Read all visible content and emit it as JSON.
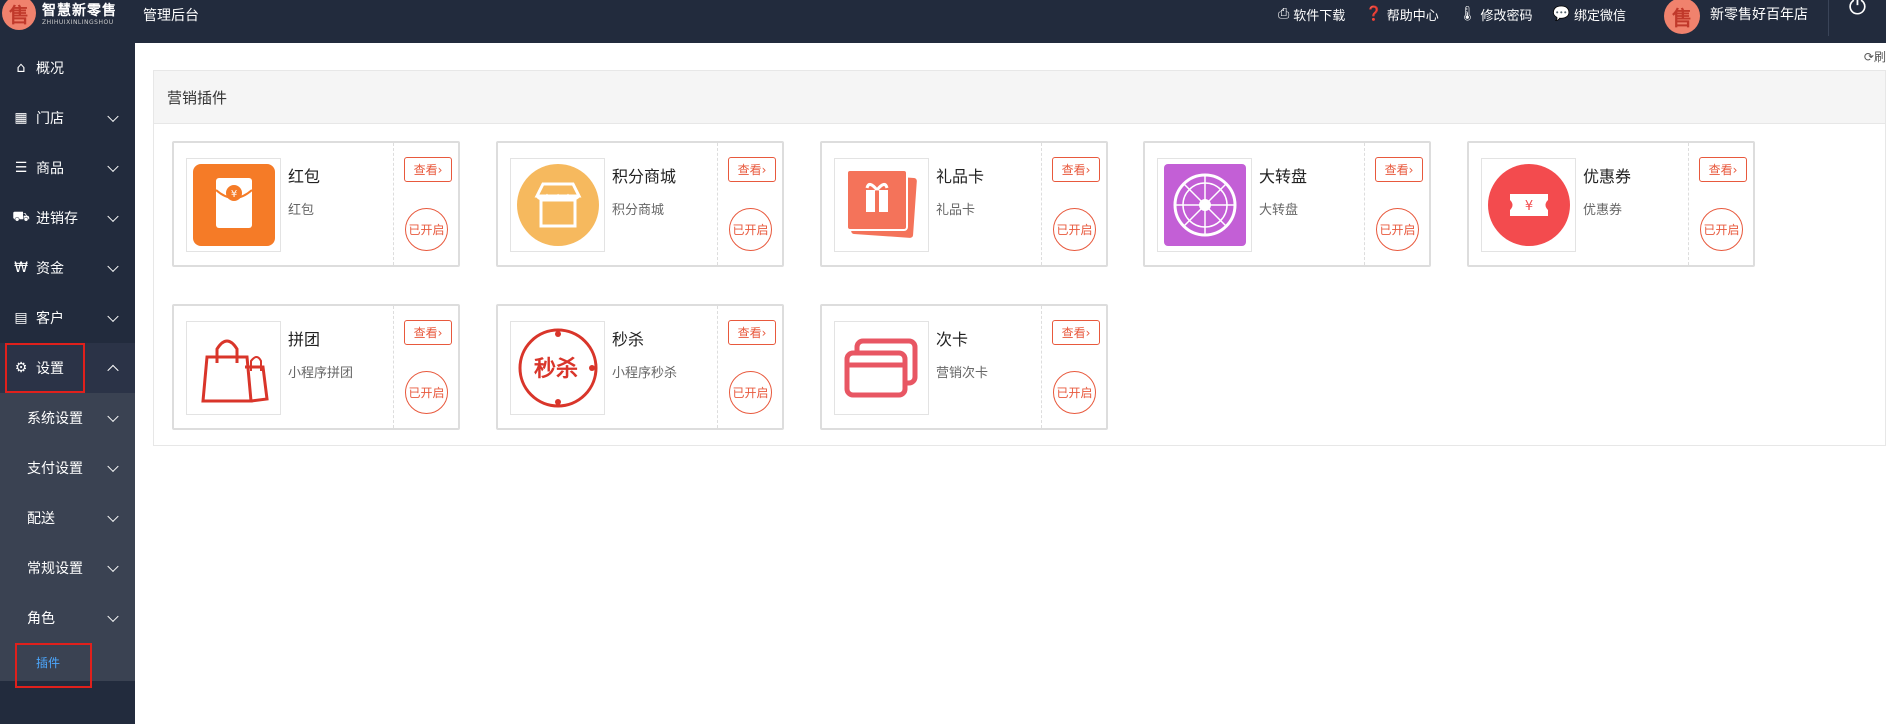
{
  "topbar": {
    "logo_cn": "智慧新零售",
    "logo_en": "ZHIHUIXINLINGSHOU",
    "title": "管理后台",
    "links": [
      {
        "icon": "printer-icon",
        "label": "软件下载"
      },
      {
        "icon": "help-icon",
        "label": "帮助中心"
      },
      {
        "icon": "thermometer-icon",
        "label": "修改密码"
      },
      {
        "icon": "chat-icon",
        "label": "绑定微信"
      }
    ],
    "user_name": "新零售好百年店"
  },
  "sidebar": {
    "items": [
      {
        "label": "概况",
        "icon": "home-icon"
      },
      {
        "label": "门店",
        "icon": "building-icon"
      },
      {
        "label": "商品",
        "icon": "list-icon"
      },
      {
        "label": "进销存",
        "icon": "truck-icon"
      },
      {
        "label": "资金",
        "icon": "won-icon"
      },
      {
        "label": "客户",
        "icon": "id-card-icon"
      },
      {
        "label": "设置",
        "icon": "gear-icon"
      }
    ],
    "sub_items": [
      {
        "label": "系统设置"
      },
      {
        "label": "支付设置"
      },
      {
        "label": "配送"
      },
      {
        "label": "常规设置"
      },
      {
        "label": "角色"
      }
    ],
    "leaf": "插件"
  },
  "main": {
    "refresh_label": "刷",
    "panel_title": "营销插件",
    "view_label": "查看",
    "plugins": [
      {
        "name": "红包",
        "desc": "红包",
        "status": "已开启",
        "icon": "red-envelope-icon",
        "color": "#f57b27"
      },
      {
        "name": "积分商城",
        "desc": "积分商城",
        "status": "已开启",
        "icon": "store-icon",
        "color": "#f6b95e"
      },
      {
        "name": "礼品卡",
        "desc": "礼品卡",
        "status": "已开启",
        "icon": "gift-card-icon",
        "color": "#f4735a"
      },
      {
        "name": "大转盘",
        "desc": "大转盘",
        "status": "已开启",
        "icon": "wheel-icon",
        "color": "#c35fd6"
      },
      {
        "name": "优惠券",
        "desc": "优惠券",
        "status": "已开启",
        "icon": "coupon-icon",
        "color": "#f34b4e"
      },
      {
        "name": "拼团",
        "desc": "小程序拼团",
        "status": "已开启",
        "icon": "shopping-bag-icon",
        "color": "#d9352a"
      },
      {
        "name": "秒杀",
        "desc": "小程序秒杀",
        "status": "已开启",
        "icon": "flash-sale-icon",
        "color": "#d9352a",
        "icon_text": "秒杀"
      },
      {
        "name": "次卡",
        "desc": "营销次卡",
        "status": "已开启",
        "icon": "cards-icon",
        "color": "#e85663"
      }
    ]
  }
}
